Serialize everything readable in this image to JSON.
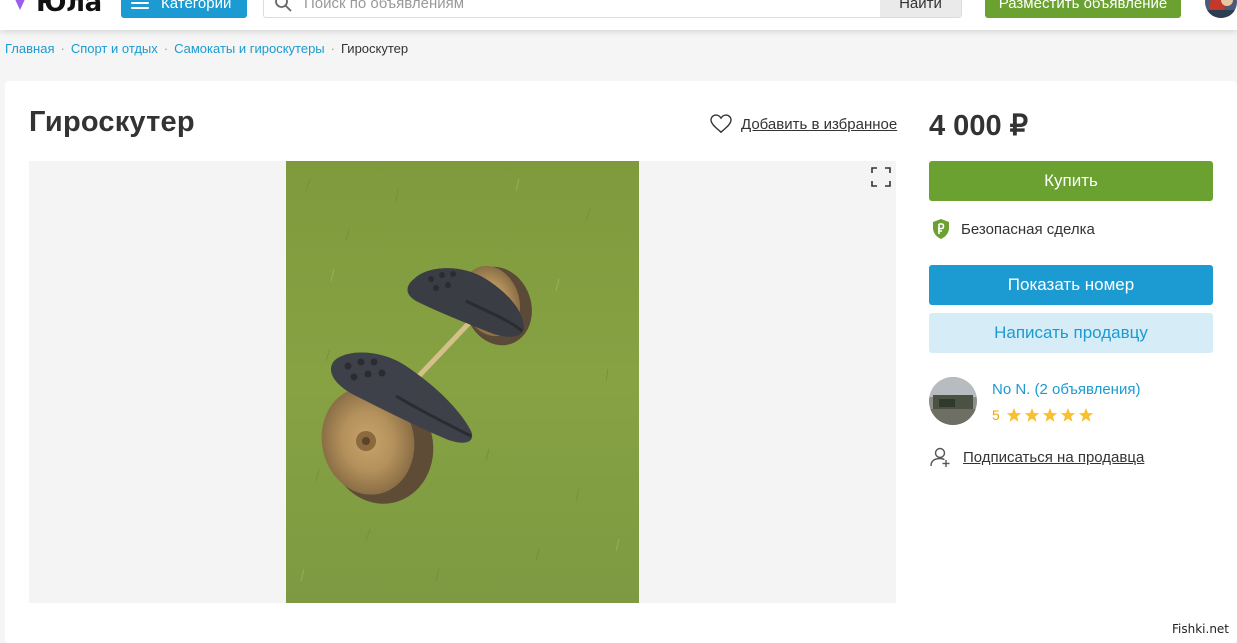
{
  "header": {
    "logo_text": "Юла",
    "categories_label": "Категории",
    "search": {
      "placeholder": "Поиск по объявлениям",
      "button_label": "Найти"
    },
    "post_ad_label": "Разместить объявление",
    "colors": {
      "brand_blue": "#1b9bd1",
      "brand_green": "#6aa130",
      "logo_accent": "#9b5cf0"
    }
  },
  "breadcrumb": {
    "items": [
      "Главная",
      "Спорт и отдых",
      "Самокаты и гироскутеры"
    ],
    "current": "Гироскутер",
    "separator": "·"
  },
  "listing": {
    "title": "Гироскутер",
    "favorite_label": "Добавить в избранное",
    "price": "4 000 ₽",
    "buy_label": "Купить",
    "safe_deal_label": "Безопасная сделка",
    "show_phone_label": "Показать номер",
    "write_seller_label": "Написать продавцу"
  },
  "seller": {
    "name": "No N. (2 объявления)",
    "rating_value": "5",
    "stars": 5,
    "subscribe_label": "Подписаться на продавца"
  },
  "watermark": "Fishki.net",
  "icons": {
    "heart": "heart-icon",
    "expand": "expand-icon",
    "shield": "shield-ruble-icon",
    "star": "star-icon",
    "subscribe": "subscribe-user-icon",
    "search": "search-icon",
    "menu": "menu-icon"
  }
}
